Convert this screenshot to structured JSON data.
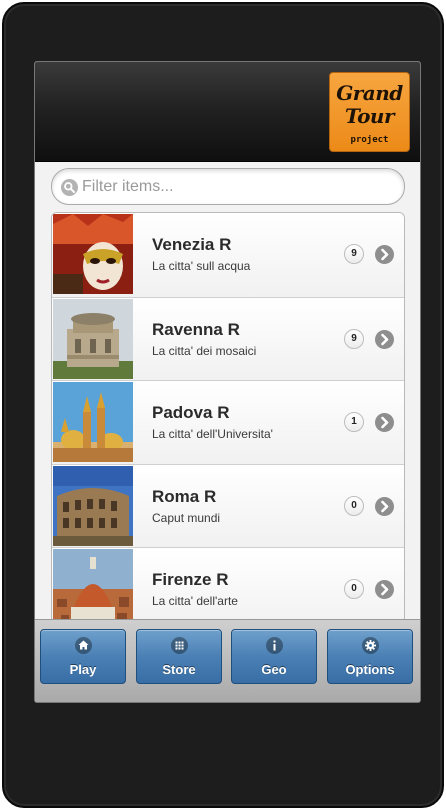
{
  "header": {
    "logo": {
      "line1": "Grand",
      "line2": "Tour",
      "line3": "project"
    }
  },
  "search": {
    "placeholder": "Filter items..."
  },
  "items": [
    {
      "title": "Venezia R",
      "subtitle": "La citta' sull acqua",
      "count": "9",
      "image": "venezia-mask"
    },
    {
      "title": "Ravenna R",
      "subtitle": "La citta' dei mosaici",
      "count": "9",
      "image": "ravenna-mausoleum"
    },
    {
      "title": "Padova R",
      "subtitle": "La citta' dell'Universita'",
      "count": "1",
      "image": "padova-basilica"
    },
    {
      "title": "Roma R",
      "subtitle": "Caput mundi",
      "count": "0",
      "image": "roma-colosseum"
    },
    {
      "title": "Firenze R",
      "subtitle": "La citta' dell'arte",
      "count": "0",
      "image": "firenze-duomo"
    }
  ],
  "navbar": [
    {
      "label": "Play",
      "icon": "home-icon"
    },
    {
      "label": "Store",
      "icon": "grid-icon"
    },
    {
      "label": "Geo",
      "icon": "info-icon"
    },
    {
      "label": "Options",
      "icon": "gear-icon"
    }
  ],
  "colors": {
    "logo_orange": "#f29a2e",
    "nav_blue": "#4b80b5",
    "header_dark": "#1a1a1a"
  }
}
